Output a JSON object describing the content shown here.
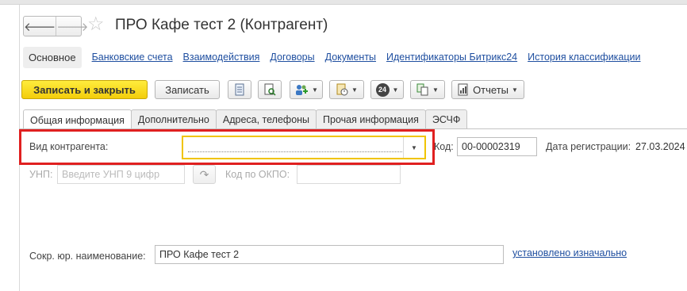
{
  "window": {
    "title": "ПРО Кафе тест 2 (Контрагент)",
    "back_icon": "arrow-left-icon",
    "forward_icon": "arrow-right-icon",
    "favorite_icon": "star-icon"
  },
  "topnav": {
    "current": "Основное",
    "links": [
      "Банковские счета",
      "Взаимодействия",
      "Договоры",
      "Документы",
      "Идентификаторы Битрикс24",
      "История классификации"
    ]
  },
  "toolbar": {
    "save_close": "Записать и закрыть",
    "save": "Записать",
    "reports": "Отчеты",
    "badge": "24"
  },
  "tabs": [
    "Общая информация",
    "Дополнительно",
    "Адреса, телефоны",
    "Прочая информация",
    "ЭСЧФ"
  ],
  "form": {
    "type_label": "Вид контрагента:",
    "type_value": "",
    "code_label": "Код:",
    "code_value": "00-00002319",
    "reg_label": "Дата регистрации:",
    "reg_value": "27.03.2024",
    "unp_label": "УНП:",
    "unp_placeholder": "Введите УНП 9 цифр",
    "okpo_label": "Код по ОКПО:",
    "okpo_value": "",
    "short_name_label": "Сокр. юр. наименование:",
    "short_name_value": "ПРО Кафе тест 2",
    "short_name_link": "установлено изначально"
  },
  "colors": {
    "primary_button": "#f5d316",
    "highlight_border": "#e02020",
    "link": "#1f4fa0",
    "focus_border": "#f0c400"
  }
}
